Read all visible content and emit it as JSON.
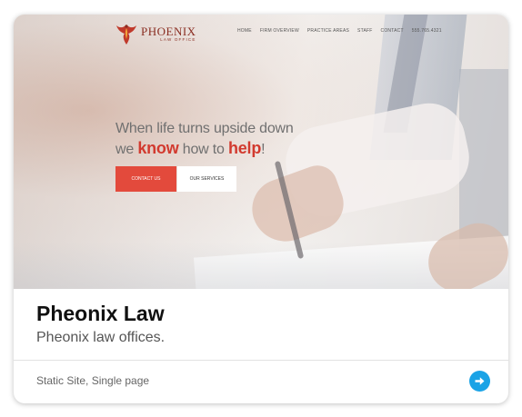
{
  "preview": {
    "logo": {
      "name": "PHOENIX",
      "subtitle": "LAW OFFICE",
      "icon": "phoenix-logo-icon"
    },
    "nav": [
      "HOME",
      "FIRM OVERVIEW",
      "PRACTICE AREAS",
      "STAFF",
      "CONTACT",
      "555.765.4321"
    ],
    "headline_line1": "When life turns upside down",
    "headline_line2_pre": "we ",
    "headline_line2_know": "know",
    "headline_line2_mid": " how to ",
    "headline_line2_help": "help",
    "headline_line2_end": "!",
    "contact_button": "CONTACT US",
    "services_button": "OUR SERVICES"
  },
  "card": {
    "title": "Pheonix Law",
    "description": "Pheonix law offices.",
    "tags": "Static Site, Single page",
    "open_icon": "arrow-right-circle-icon"
  },
  "colors": {
    "accent_red": "#e34a3c",
    "brand_dark_red": "#8a2e22",
    "link_blue": "#1aa3e6"
  }
}
